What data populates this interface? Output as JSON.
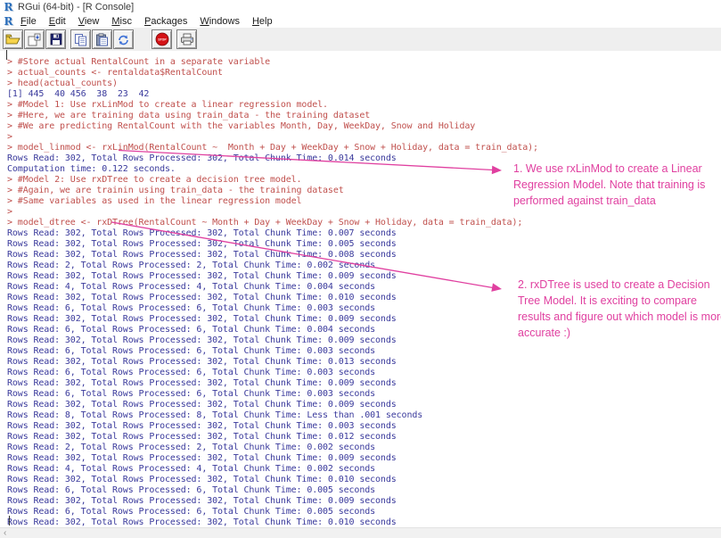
{
  "colors": {
    "annotation": "#e040a0",
    "input_red": "#c0504d",
    "output_blue": "#3a3a9c"
  },
  "window": {
    "title": "RGui (64-bit) - [R Console]"
  },
  "menu": {
    "items": [
      "File",
      "Edit",
      "View",
      "Misc",
      "Packages",
      "Windows",
      "Help"
    ]
  },
  "toolbar": {
    "buttons": [
      "open-script",
      "load-workspace",
      "save-workspace",
      "copy",
      "paste",
      "copy-and-paste",
      "stop-computation",
      "print"
    ],
    "stop_label": "STOP"
  },
  "console": {
    "lines": [
      {
        "c": "input",
        "t": "> #Store actual RentalCount in a separate variable"
      },
      {
        "c": "input",
        "t": "> actual_counts <- rentaldata$RentalCount"
      },
      {
        "c": "input",
        "t": "> head(actual_counts)"
      },
      {
        "c": "output",
        "t": "[1] 445  40 456  38  23  42"
      },
      {
        "c": "input",
        "t": "> #Model 1: Use rxLinMod to create a linear regression model."
      },
      {
        "c": "input",
        "t": "> #Here, we are training data using train_data - the training dataset"
      },
      {
        "c": "input",
        "t": "> #We are predicting RentalCount with the variables Month, Day, WeekDay, Snow and Holiday"
      },
      {
        "c": "input",
        "t": ">"
      },
      {
        "c": "input",
        "t": "> model_linmod <- rxLinMod(RentalCount ~  Month + Day + WeekDay + Snow + Holiday, data = train_data);"
      },
      {
        "c": "output",
        "t": "Rows Read: 302, Total Rows Processed: 302, Total Chunk Time: 0.014 seconds"
      },
      {
        "c": "output",
        "t": "Computation time: 0.122 seconds."
      },
      {
        "c": "input",
        "t": "> #Model 2: Use rxDTree to create a decision tree model."
      },
      {
        "c": "input",
        "t": "> #Again, we are trainin using train_data - the training dataset"
      },
      {
        "c": "input",
        "t": "> #Same variables as used in the linear regression model"
      },
      {
        "c": "input",
        "t": ">"
      },
      {
        "c": "input",
        "t": "> model_dtree <- rxDTree(RentalCount ~ Month + Day + WeekDay + Snow + Holiday, data = train_data);"
      },
      {
        "c": "output",
        "t": "Rows Read: 302, Total Rows Processed: 302, Total Chunk Time: 0.007 seconds"
      },
      {
        "c": "output",
        "t": "Rows Read: 302, Total Rows Processed: 302, Total Chunk Time: 0.005 seconds"
      },
      {
        "c": "output",
        "t": "Rows Read: 302, Total Rows Processed: 302, Total Chunk Time: 0.008 seconds"
      },
      {
        "c": "output",
        "t": "Rows Read: 2, Total Rows Processed: 2, Total Chunk Time: 0.002 seconds"
      },
      {
        "c": "output",
        "t": "Rows Read: 302, Total Rows Processed: 302, Total Chunk Time: 0.009 seconds"
      },
      {
        "c": "output",
        "t": "Rows Read: 4, Total Rows Processed: 4, Total Chunk Time: 0.004 seconds"
      },
      {
        "c": "output",
        "t": "Rows Read: 302, Total Rows Processed: 302, Total Chunk Time: 0.010 seconds"
      },
      {
        "c": "output",
        "t": "Rows Read: 6, Total Rows Processed: 6, Total Chunk Time: 0.003 seconds"
      },
      {
        "c": "output",
        "t": "Rows Read: 302, Total Rows Processed: 302, Total Chunk Time: 0.009 seconds"
      },
      {
        "c": "output",
        "t": "Rows Read: 6, Total Rows Processed: 6, Total Chunk Time: 0.004 seconds"
      },
      {
        "c": "output",
        "t": "Rows Read: 302, Total Rows Processed: 302, Total Chunk Time: 0.009 seconds"
      },
      {
        "c": "output",
        "t": "Rows Read: 6, Total Rows Processed: 6, Total Chunk Time: 0.003 seconds"
      },
      {
        "c": "output",
        "t": "Rows Read: 302, Total Rows Processed: 302, Total Chunk Time: 0.013 seconds"
      },
      {
        "c": "output",
        "t": "Rows Read: 6, Total Rows Processed: 6, Total Chunk Time: 0.003 seconds"
      },
      {
        "c": "output",
        "t": "Rows Read: 302, Total Rows Processed: 302, Total Chunk Time: 0.009 seconds"
      },
      {
        "c": "output",
        "t": "Rows Read: 6, Total Rows Processed: 6, Total Chunk Time: 0.003 seconds"
      },
      {
        "c": "output",
        "t": "Rows Read: 302, Total Rows Processed: 302, Total Chunk Time: 0.009 seconds"
      },
      {
        "c": "output",
        "t": "Rows Read: 8, Total Rows Processed: 8, Total Chunk Time: Less than .001 seconds"
      },
      {
        "c": "output",
        "t": "Rows Read: 302, Total Rows Processed: 302, Total Chunk Time: 0.003 seconds"
      },
      {
        "c": "output",
        "t": "Rows Read: 302, Total Rows Processed: 302, Total Chunk Time: 0.012 seconds"
      },
      {
        "c": "output",
        "t": "Rows Read: 2, Total Rows Processed: 2, Total Chunk Time: 0.002 seconds"
      },
      {
        "c": "output",
        "t": "Rows Read: 302, Total Rows Processed: 302, Total Chunk Time: 0.009 seconds"
      },
      {
        "c": "output",
        "t": "Rows Read: 4, Total Rows Processed: 4, Total Chunk Time: 0.002 seconds"
      },
      {
        "c": "output",
        "t": "Rows Read: 302, Total Rows Processed: 302, Total Chunk Time: 0.010 seconds"
      },
      {
        "c": "output",
        "t": "Rows Read: 6, Total Rows Processed: 6, Total Chunk Time: 0.005 seconds"
      },
      {
        "c": "output",
        "t": "Rows Read: 302, Total Rows Processed: 302, Total Chunk Time: 0.009 seconds"
      },
      {
        "c": "output",
        "t": "Rows Read: 6, Total Rows Processed: 6, Total Chunk Time: 0.005 seconds"
      },
      {
        "c": "output",
        "t": "Rows Read: 302, Total Rows Processed: 302, Total Chunk Time: 0.010 seconds"
      }
    ]
  },
  "annotations": [
    {
      "lines": [
        "1. We use rxLinMod to create a Linear",
        "Regression Model. Note that training is",
        "performed against train_data"
      ]
    },
    {
      "lines": [
        "2. rxDTree is used to create a Decision",
        "Tree Model. It is exciting to compare",
        "results and figure out which model is more",
        "accurate :)"
      ]
    }
  ],
  "scrollbar": {
    "left_arrow": "‹"
  }
}
